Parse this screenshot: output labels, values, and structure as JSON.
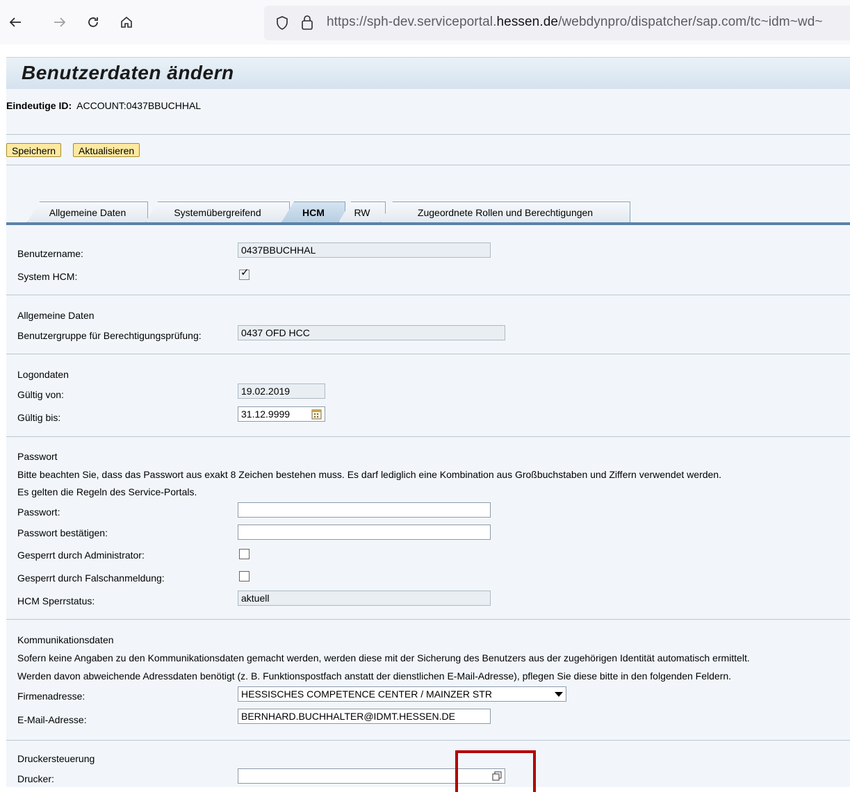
{
  "browser": {
    "url_prefix": "https://sph-dev.serviceportal.",
    "url_domain": "hessen.de",
    "url_suffix": "/webdynpro/dispatcher/sap.com/tc~idm~wd~"
  },
  "page": {
    "title": "Benutzerdaten ändern",
    "uid_label": "Eindeutige ID:",
    "uid_value": "ACCOUNT:0437BBUCHHAL"
  },
  "toolbar": {
    "save": "Speichern",
    "refresh": "Aktualisieren"
  },
  "tabs": [
    {
      "label": "Allgemeine Daten"
    },
    {
      "label": "Systemübergreifend"
    },
    {
      "label": "HCM"
    },
    {
      "label": "RW"
    },
    {
      "label": "Zugeordnete Rollen und Berechtigungen"
    }
  ],
  "form": {
    "username_label": "Benutzername:",
    "username_value": "0437BBUCHHAL",
    "system_hcm_label": "System HCM:",
    "general_header": "Allgemeine Daten",
    "usergroup_label": "Benutzergruppe für Berechtigungsprüfung:",
    "usergroup_value": "0437 OFD HCC",
    "logon_header": "Logondaten",
    "valid_from_label": "Gültig von:",
    "valid_from_value": "19.02.2019",
    "valid_to_label": "Gültig bis:",
    "valid_to_value": "31.12.9999",
    "password_header": "Passwort",
    "password_hint1": "Bitte beachten Sie, dass das Passwort aus exakt 8 Zeichen bestehen muss. Es darf lediglich eine Kombination aus Großbuchstaben und Ziffern verwendet werden.",
    "password_hint2": "Es gelten die Regeln des Service-Portals.",
    "password_label": "Passwort:",
    "password_confirm_label": "Passwort bestätigen:",
    "locked_admin_label": "Gesperrt durch Administrator:",
    "locked_wrong_label": "Gesperrt durch Falschanmeldung:",
    "hcm_lock_label": "HCM Sperrstatus:",
    "hcm_lock_value": "aktuell",
    "comm_header": "Kommunikationsdaten",
    "comm_hint1": "Sofern keine Angaben zu den Kommunikationsdaten gemacht werden, werden diese mit der Sicherung des Benutzers aus der zugehörigen Identität automatisch ermittelt.",
    "comm_hint2": "Werden davon abweichende Adressdaten benötigt (z. B. Funktionspostfach anstatt der dienstlichen E-Mail-Adresse), pflegen Sie diese bitte in den folgenden Feldern.",
    "company_label": "Firmenadresse:",
    "company_value": "HESSISCHES COMPETENCE CENTER / MAINZER STR",
    "email_label": "E-Mail-Adresse:",
    "email_value": "BERNHARD.BUCHHALTER@IDMT.HESSEN.DE",
    "printer_header": "Druckersteuerung",
    "printer_label": "Drucker:"
  }
}
